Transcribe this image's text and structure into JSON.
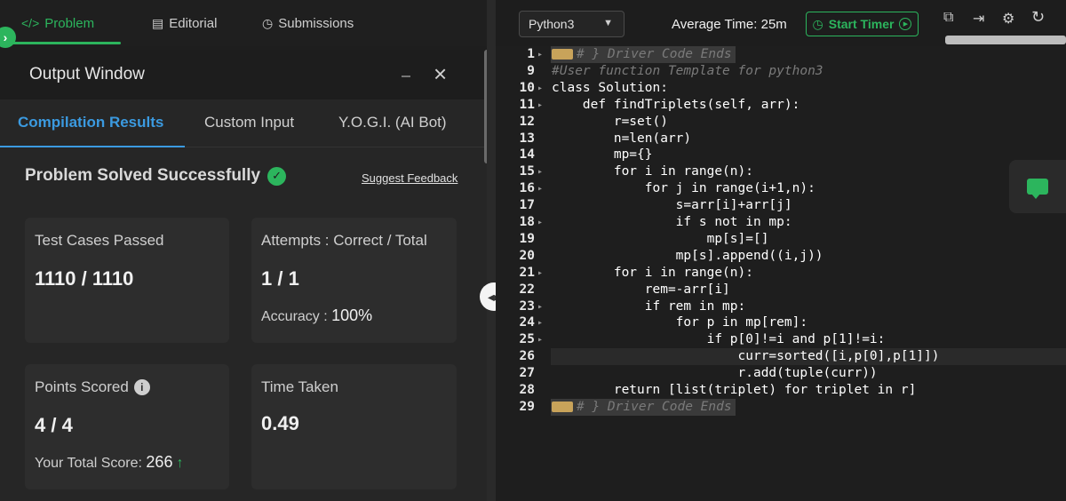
{
  "nav": {
    "tabs": [
      {
        "label": "Problem",
        "icon": "</>"
      },
      {
        "label": "Editorial",
        "icon": "doc-icon"
      },
      {
        "label": "Submissions",
        "icon": "clock-icon"
      }
    ]
  },
  "output": {
    "title": "Output Window",
    "tabs": [
      "Compilation Results",
      "Custom Input",
      "Y.O.G.I. (AI Bot)"
    ],
    "status": "Problem Solved Successfully",
    "feedback_link": "Suggest Feedback",
    "cards": {
      "tests": {
        "label": "Test Cases Passed",
        "value": "1110 / 1110"
      },
      "attempts": {
        "label": "Attempts : Correct / Total",
        "value": "1 / 1",
        "sub_label": "Accuracy : ",
        "sub_value": "100%"
      },
      "points": {
        "label": "Points Scored",
        "value": "4 / 4",
        "sub_label": "Your Total Score: ",
        "sub_value": "266"
      },
      "time": {
        "label": "Time Taken",
        "value": "0.49"
      }
    }
  },
  "editor": {
    "language": "Python3",
    "avg_time": "Average Time: 25m",
    "timer_label": "Start Timer",
    "lines": [
      {
        "n": "1",
        "text": "# } Driver Code Ends",
        "comment": true,
        "badge": true
      },
      {
        "n": "9",
        "text": "#User function Template for python3",
        "comment": true
      },
      {
        "n": "10",
        "text": "class Solution:"
      },
      {
        "n": "11",
        "text": "    def findTriplets(self, arr):"
      },
      {
        "n": "12",
        "text": "        r=set()"
      },
      {
        "n": "13",
        "text": "        n=len(arr)"
      },
      {
        "n": "14",
        "text": "        mp={}"
      },
      {
        "n": "15",
        "text": "        for i in range(n):"
      },
      {
        "n": "16",
        "text": "            for j in range(i+1,n):"
      },
      {
        "n": "17",
        "text": "                s=arr[i]+arr[j]"
      },
      {
        "n": "18",
        "text": "                if s not in mp:"
      },
      {
        "n": "19",
        "text": "                    mp[s]=[]"
      },
      {
        "n": "20",
        "text": "                mp[s].append((i,j))"
      },
      {
        "n": "21",
        "text": "        for i in range(n):"
      },
      {
        "n": "22",
        "text": "            rem=-arr[i]"
      },
      {
        "n": "23",
        "text": "            if rem in mp:"
      },
      {
        "n": "24",
        "text": "                for p in mp[rem]:"
      },
      {
        "n": "25",
        "text": "                    if p[0]!=i and p[1]!=i:"
      },
      {
        "n": "26",
        "text": "                        curr=sorted([i,p[0],p[1]])"
      },
      {
        "n": "27",
        "text": "                        r.add(tuple(curr))"
      },
      {
        "n": "28",
        "text": "        return [list(triplet) for triplet in r]"
      },
      {
        "n": "29",
        "text": "# } Driver Code Ends",
        "comment": true,
        "badge": true
      }
    ]
  },
  "colors": {
    "accent": "#2cb55d",
    "link_blue": "#3b9ae0"
  }
}
